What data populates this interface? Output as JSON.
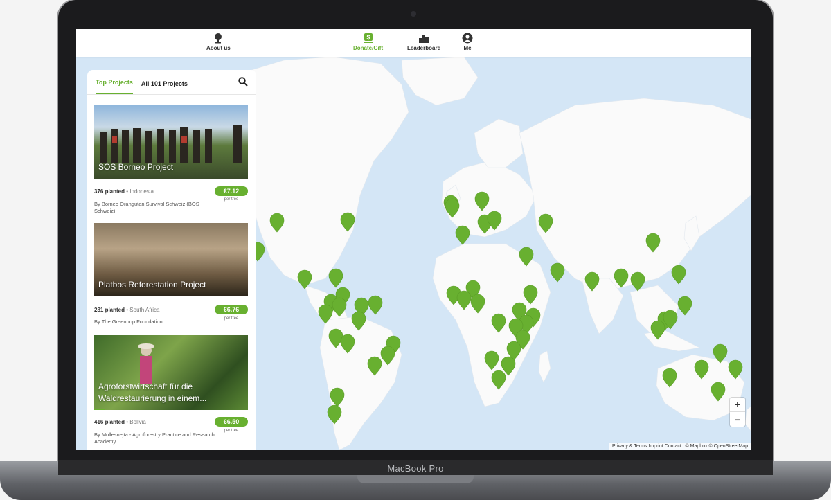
{
  "device": {
    "brand_label": "MacBook Pro"
  },
  "nav": {
    "about": "About us",
    "donate": "Donate/Gift",
    "leaderboard": "Leaderboard",
    "me": "Me"
  },
  "panel": {
    "tab_top": "Top Projects",
    "tab_all": "All 101 Projects",
    "projects": [
      {
        "title": "SOS Borneo Project",
        "planted": "376 planted",
        "country": "Indonesia",
        "price": "€7.12",
        "per": "per tree",
        "by": "By Borneo Orangutan Survival Schweiz (BOS Schweiz)"
      },
      {
        "title": "Platbos Reforestation Project",
        "planted": "281 planted",
        "country": "South Africa",
        "price": "€6.76",
        "per": "per tree",
        "by": "By The Greenpop Foundation"
      },
      {
        "title": "Agroforstwirtschaft für die Waldrestaurierung in einem...",
        "planted": "416 planted",
        "country": "Bolivia",
        "price": "€6.50",
        "per": "per tree",
        "by": "By Mollesnejta - Agroforestry Practice and Research Academy"
      }
    ]
  },
  "map": {
    "zoom_in": "+",
    "zoom_out": "−",
    "attribution": "Privacy & Terms  Imprint  Contact  | © Mapbox © OpenStreetMap"
  },
  "colors": {
    "accent": "#68b030",
    "water": "#d4e6f6",
    "land": "#fafafa"
  }
}
